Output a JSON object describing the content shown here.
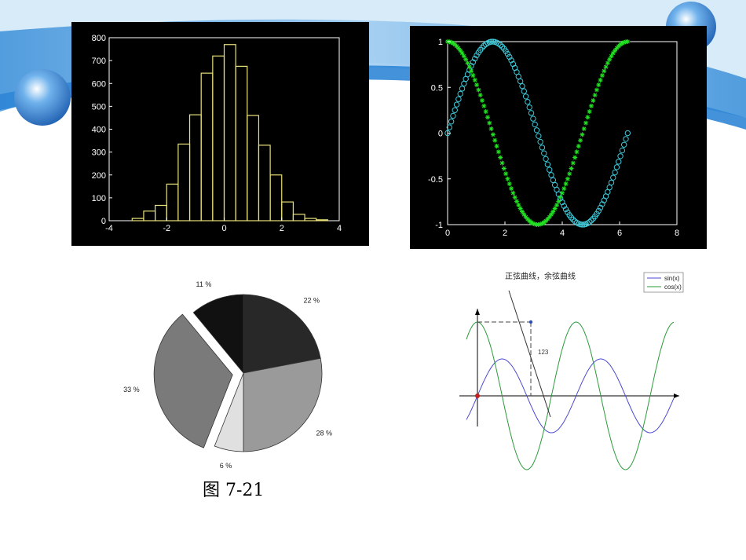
{
  "caption": "图 7-21",
  "theme": {
    "accent_blue": "#2f86d6",
    "light_blue": "#cfe6f7"
  },
  "chart_data": [
    {
      "type": "bar",
      "title": "",
      "xlabel": "",
      "ylabel": "",
      "x": [
        -3.0,
        -2.6,
        -2.2,
        -1.8,
        -1.4,
        -1.0,
        -0.6,
        -0.2,
        0.2,
        0.6,
        1.0,
        1.4,
        1.8,
        2.2,
        2.6,
        3.0,
        3.4
      ],
      "values": [
        10,
        42,
        67,
        160,
        335,
        463,
        645,
        720,
        770,
        675,
        460,
        330,
        200,
        82,
        28,
        10,
        4
      ],
      "xlim": [
        -4,
        4
      ],
      "ylim": [
        0,
        800
      ],
      "xticks": [
        "-4",
        "-2",
        "0",
        "2",
        "4"
      ],
      "yticks": [
        "0",
        "100",
        "200",
        "300",
        "400",
        "500",
        "600",
        "700",
        "800"
      ],
      "colors": {
        "bars": "#e8e07a",
        "axes": "#ffffff",
        "background": "#000000"
      },
      "grid": false
    },
    {
      "type": "scatter",
      "title": "",
      "xlabel": "",
      "ylabel": "",
      "series": [
        {
          "function": "sin(x)",
          "x_range": [
            0,
            6.283
          ],
          "points": 100,
          "marker": "o",
          "color": "#3ec8d8"
        },
        {
          "function": "cos(x)",
          "x_range": [
            0,
            6.283
          ],
          "points": 100,
          "marker": "*",
          "color": "#22e022"
        }
      ],
      "xlim": [
        0,
        8
      ],
      "ylim": [
        -1,
        1
      ],
      "xticks": [
        "0",
        "2",
        "4",
        "6",
        "8"
      ],
      "yticks": [
        "-1",
        "-0.5",
        "0",
        "0.5",
        "1"
      ],
      "grid": false
    },
    {
      "type": "pie",
      "labels": [
        "22 %",
        "28 %",
        "6 %",
        "33 %",
        "11 %"
      ],
      "values": [
        22,
        28,
        6,
        33,
        11
      ],
      "colors": [
        "#282828",
        "#9a9a9a",
        "#e0e0e0",
        "#7a7a7a",
        "#111111"
      ],
      "exploded": [
        false,
        false,
        false,
        true,
        false
      ]
    },
    {
      "type": "line",
      "title": "正弦曲线，余弦曲线",
      "legend": [
        "sin(x)",
        "cos(x)"
      ],
      "legend_position": "top-right",
      "series": [
        {
          "name": "sin(x)",
          "function": "sin(x)",
          "color": "#4a4ad0"
        },
        {
          "name": "cos(x)",
          "function": "2cos(x)",
          "color": "#2a9a3a"
        }
      ],
      "x_range": [
        -0.7,
        12.5
      ],
      "annotation": "123",
      "grid": false
    }
  ]
}
